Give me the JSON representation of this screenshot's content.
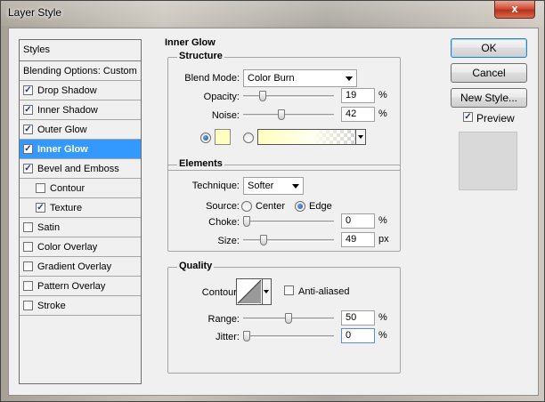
{
  "window": {
    "title": "Layer Style",
    "close_glyph": "x"
  },
  "left_panel": {
    "header": "Styles",
    "blending_options": "Blending Options: Custom",
    "items": [
      {
        "label": "Drop Shadow",
        "checked": true,
        "indent": false,
        "selected": false
      },
      {
        "label": "Inner Shadow",
        "checked": true,
        "indent": false,
        "selected": false
      },
      {
        "label": "Outer Glow",
        "checked": true,
        "indent": false,
        "selected": false
      },
      {
        "label": "Inner Glow",
        "checked": true,
        "indent": false,
        "selected": true
      },
      {
        "label": "Bevel and Emboss",
        "checked": true,
        "indent": false,
        "selected": false
      },
      {
        "label": "Contour",
        "checked": false,
        "indent": true,
        "selected": false
      },
      {
        "label": "Texture",
        "checked": true,
        "indent": true,
        "selected": false
      },
      {
        "label": "Satin",
        "checked": false,
        "indent": false,
        "selected": false
      },
      {
        "label": "Color Overlay",
        "checked": false,
        "indent": false,
        "selected": false
      },
      {
        "label": "Gradient Overlay",
        "checked": false,
        "indent": false,
        "selected": false
      },
      {
        "label": "Pattern Overlay",
        "checked": false,
        "indent": false,
        "selected": false
      },
      {
        "label": "Stroke",
        "checked": false,
        "indent": false,
        "selected": false
      }
    ],
    "check_glyph": "✓"
  },
  "inner_glow": {
    "title": "Inner Glow",
    "structure": {
      "title": "Structure",
      "blend_mode_label": "Blend Mode:",
      "blend_mode_value": "Color Burn",
      "opacity_label": "Opacity:",
      "opacity_value": "19",
      "opacity_unit": "%",
      "opacity_fraction": 0.19,
      "noise_label": "Noise:",
      "noise_value": "42",
      "noise_unit": "%",
      "noise_fraction": 0.42,
      "glow_color": "#ffffc0",
      "glow_mode": "color"
    },
    "elements": {
      "title": "Elements",
      "technique_label": "Technique:",
      "technique_value": "Softer",
      "source_label": "Source:",
      "source_center": "Center",
      "source_edge": "Edge",
      "source_selected": "Edge",
      "choke_label": "Choke:",
      "choke_value": "0",
      "choke_unit": "%",
      "choke_fraction": 0.0,
      "size_label": "Size:",
      "size_value": "49",
      "size_unit": "px",
      "size_fraction": 0.2
    },
    "quality": {
      "title": "Quality",
      "contour_label": "Contour:",
      "anti_aliased_label": "Anti-aliased",
      "anti_aliased_checked": false,
      "range_label": "Range:",
      "range_value": "50",
      "range_unit": "%",
      "range_fraction": 0.5,
      "jitter_label": "Jitter:",
      "jitter_value": "0",
      "jitter_unit": "%",
      "jitter_fraction": 0.0
    }
  },
  "buttons": {
    "ok": "OK",
    "cancel": "Cancel",
    "new_style": "New Style...",
    "preview_label": "Preview",
    "preview_checked": true
  },
  "colors": {
    "selection": "#3399ff",
    "dialog_bg": "#f0f0f0",
    "close_red": "#c8452d"
  },
  "icons": [
    "close-icon",
    "check-icon",
    "dropdown-arrow-icon",
    "radio-icon",
    "contour-icon",
    "gradient-icon"
  ]
}
